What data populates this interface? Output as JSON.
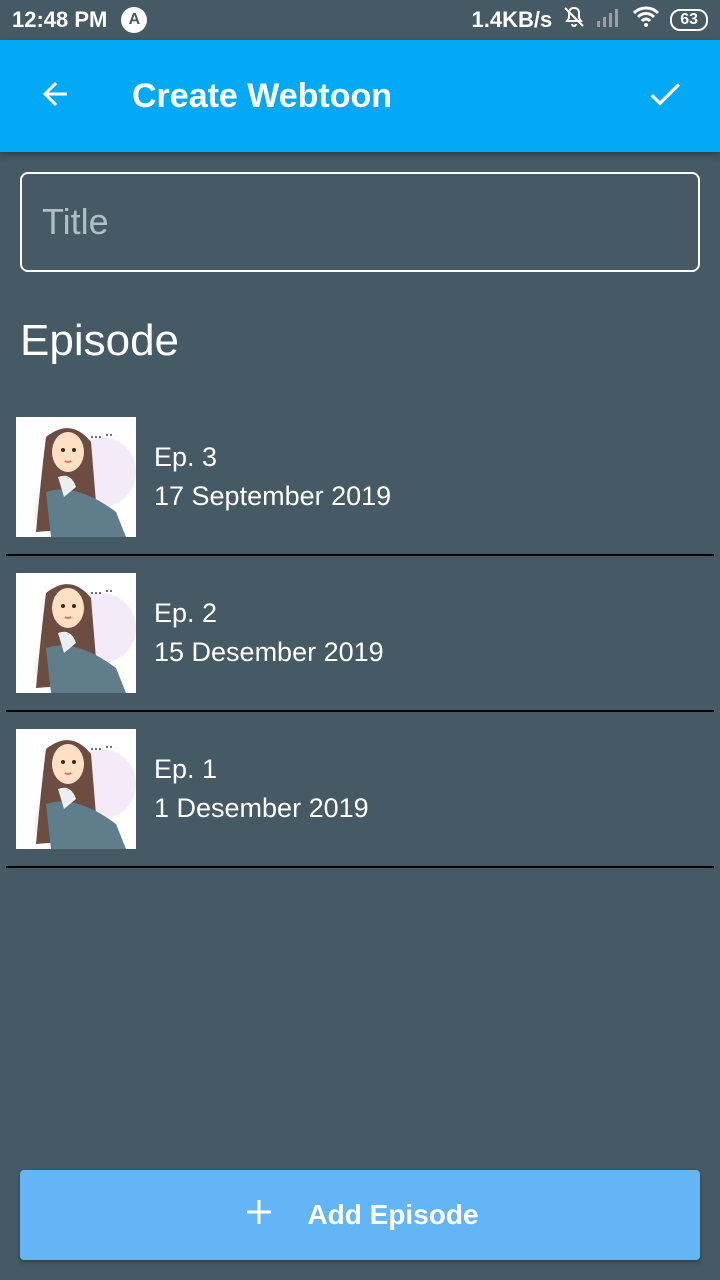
{
  "status": {
    "time": "12:48 PM",
    "app_badge": "A",
    "speed": "1.4KB/s",
    "battery": "63"
  },
  "toolbar": {
    "title": "Create Webtoon",
    "back_icon": "arrow-back-icon",
    "confirm_icon": "check-icon"
  },
  "form": {
    "title_placeholder": "Title",
    "title_value": ""
  },
  "section": {
    "heading": "Episode"
  },
  "episodes": [
    {
      "label": "Ep. 3",
      "date": "17 September 2019"
    },
    {
      "label": "Ep. 2",
      "date": "15 Desember 2019"
    },
    {
      "label": "Ep. 1",
      "date": "1 Desember 2019"
    }
  ],
  "add_button": {
    "label": "Add Episode",
    "icon": "plus-icon"
  },
  "colors": {
    "background": "#455a64",
    "toolbar": "#03a9f4",
    "add_button": "#64b5f6"
  }
}
